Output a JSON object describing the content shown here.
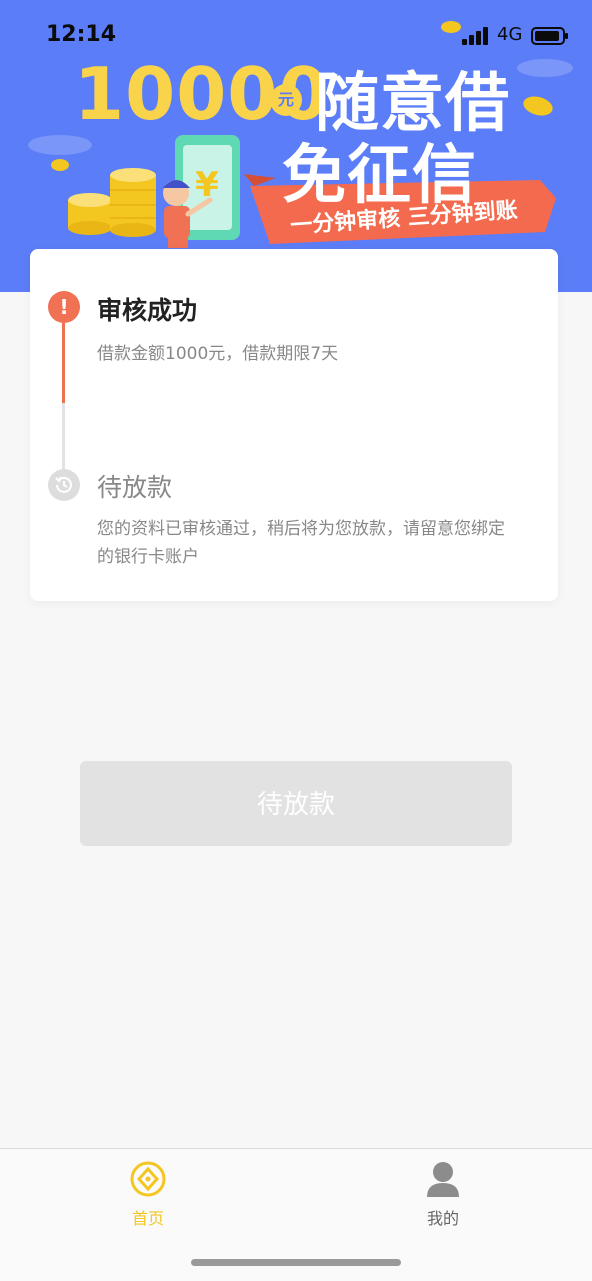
{
  "status_bar": {
    "time": "12:14",
    "network": "4G"
  },
  "banner": {
    "amount": "10000",
    "unit": "元",
    "title_line1": "随意借",
    "title_line2": "免征信",
    "ribbon": "一分钟审核 三分钟到账"
  },
  "steps": [
    {
      "title": "审核成功",
      "desc": "借款金额1000元，借款期限7天",
      "status": "done",
      "icon": "exclamation-icon",
      "color": "#f17155"
    },
    {
      "title": "待放款",
      "desc": "您的资料已审核通过，稍后将为您放款，请留意您绑定的银行卡账户",
      "status": "pending",
      "icon": "clock-history-icon",
      "color": "#dddddd"
    }
  ],
  "action_button": {
    "label": "待放款"
  },
  "tabbar": {
    "items": [
      {
        "label": "首页",
        "icon": "home-diamond-icon",
        "active": true,
        "color": "#f3c620"
      },
      {
        "label": "我的",
        "icon": "user-icon",
        "active": false,
        "color": "#666666"
      }
    ]
  },
  "colors": {
    "banner_bg": "#5b7df7",
    "accent_yellow": "#f9d34a",
    "step_active": "#f17155",
    "tab_active": "#f3c620"
  }
}
